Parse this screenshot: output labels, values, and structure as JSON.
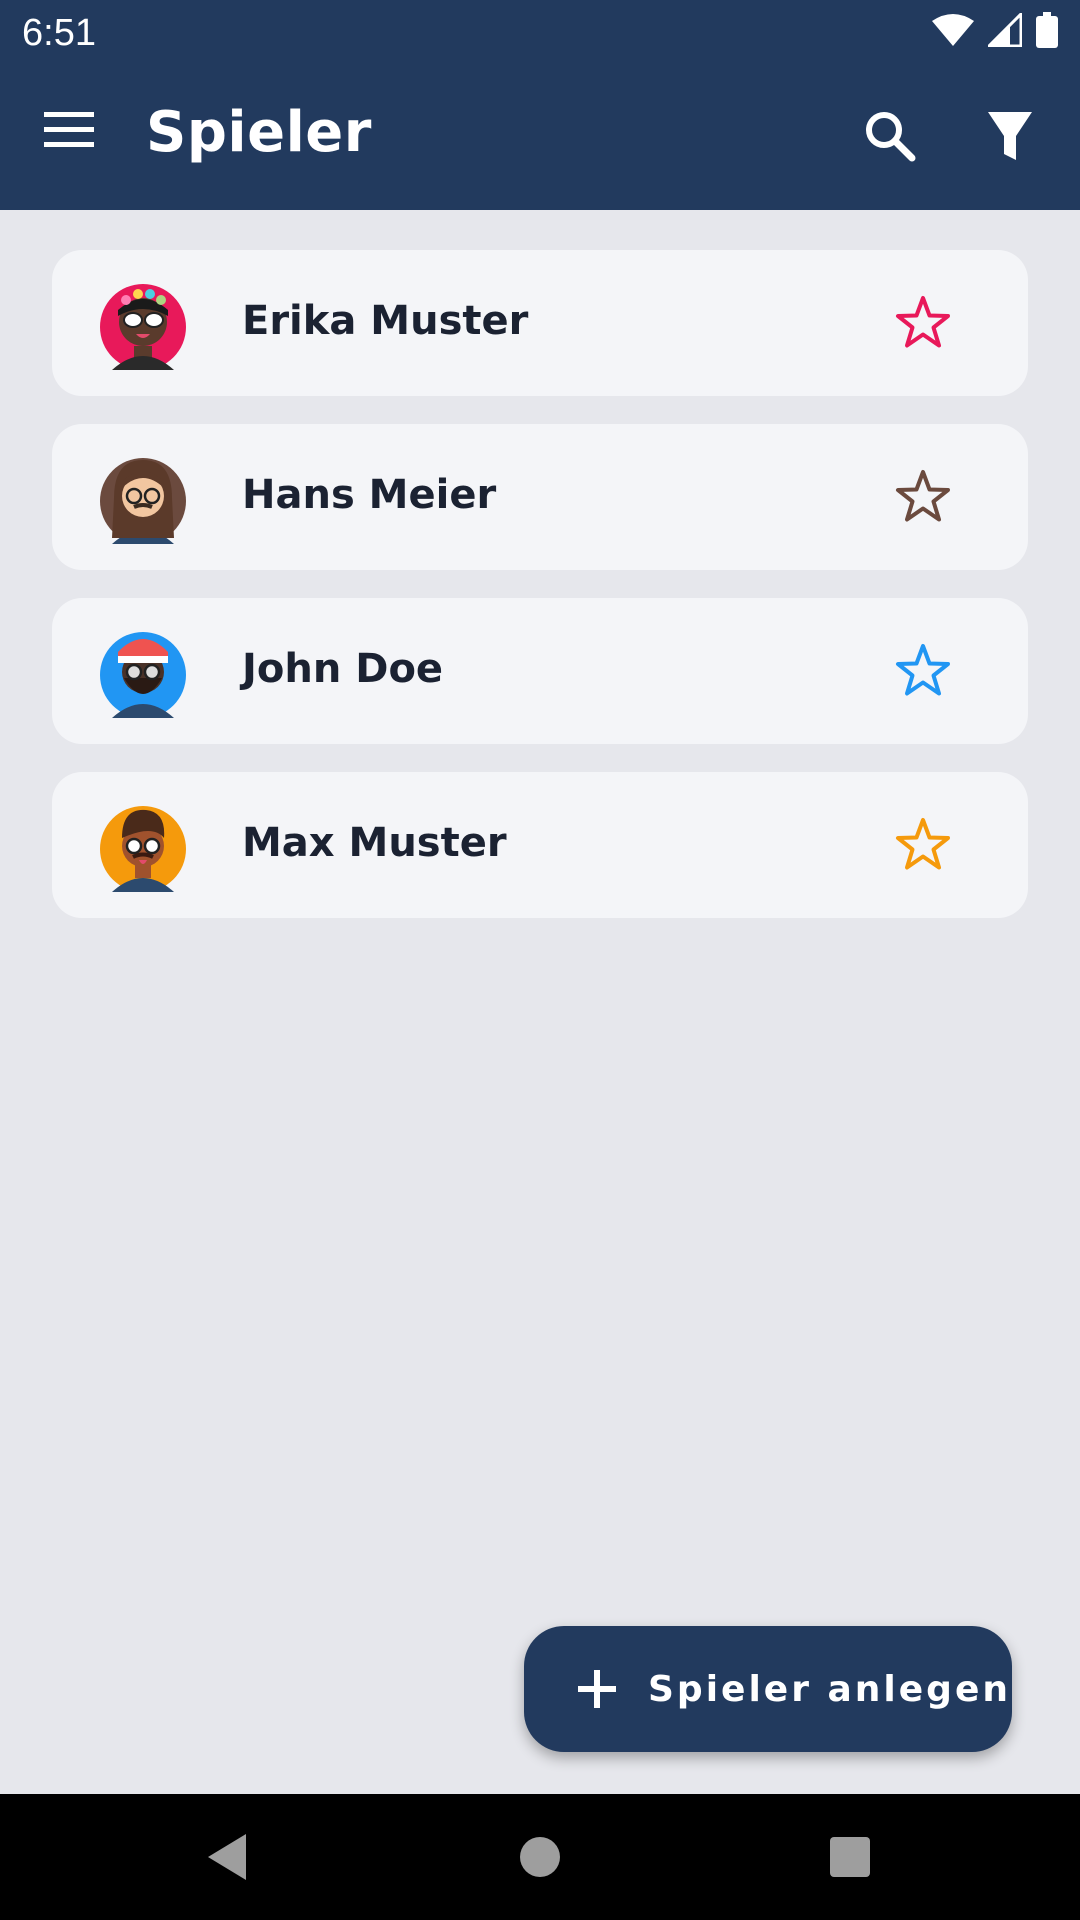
{
  "status_bar": {
    "time": "6:51",
    "icons": [
      "wifi-icon",
      "signal-icon",
      "battery-icon"
    ]
  },
  "app_bar": {
    "title": "Spieler",
    "icons": [
      "menu-icon",
      "search-icon",
      "filter-icon"
    ]
  },
  "players": [
    {
      "name": "Erika Muster",
      "star_color": "#e8195a",
      "avatar_bg": "#e8195a"
    },
    {
      "name": "Hans Meier",
      "star_color": "#6b4a3e",
      "avatar_bg": "#6b4a3e"
    },
    {
      "name": "John Doe",
      "star_color": "#2196f3",
      "avatar_bg": "#2196f3"
    },
    {
      "name": "Max Muster",
      "star_color": "#f59a0c",
      "avatar_bg": "#f59a0c"
    }
  ],
  "fab": {
    "label": "Spieler anlegen",
    "icon": "plus-icon"
  },
  "colors": {
    "primary": "#223a5e",
    "background": "#e6e7ec",
    "card": "#f4f5f8"
  }
}
